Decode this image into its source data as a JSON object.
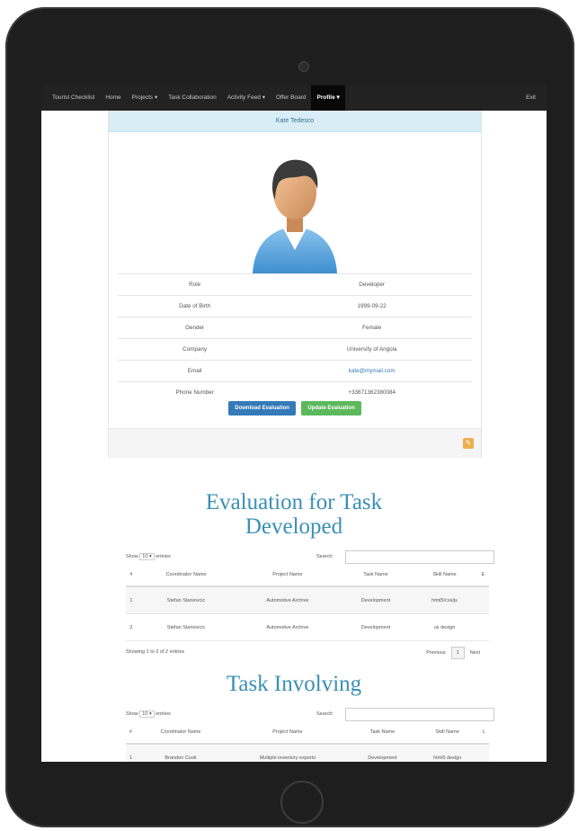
{
  "navbar": {
    "brand": "Tourist Checklist",
    "items": [
      "Home",
      "Projects ▾",
      "Task Collaboration",
      "Activity Feed ▾",
      "Offer Board",
      "Profile ▾"
    ],
    "right": "Exit"
  },
  "profile": {
    "name": "Kate Tedesco",
    "rows": [
      {
        "label": "Role",
        "value": "Developer"
      },
      {
        "label": "Date of Birth",
        "value": "1999-09-22"
      },
      {
        "label": "Gender",
        "value": "Female"
      },
      {
        "label": "Company",
        "value": "University of Angola"
      },
      {
        "label": "Email",
        "value": "kate@mymail.com"
      },
      {
        "label": "Phone Number",
        "value": "+33671362380084"
      }
    ],
    "download_label": "Download Evaluation",
    "update_label": "Update Evaluation",
    "edit_icon": "edit-icon",
    "colors": {
      "primary": "#337ab7",
      "success": "#5cb85c",
      "warning": "#f0ad4e",
      "heading": "#3a8fb5"
    }
  },
  "evaluation": {
    "title_line1": "Evaluation for Task",
    "title_line2": "Developed",
    "show_label": "Show",
    "entries_value": "10",
    "entries_label": "entries",
    "search_label": "Search:",
    "headers": [
      "#",
      "Coordinator Name",
      "Project Name",
      "Task Name",
      "Skill Name",
      "E"
    ],
    "rows": [
      [
        "1",
        "Stefan Staniovcic",
        "Automotive Archive",
        "Development",
        "html5/css/js",
        ""
      ],
      [
        "2",
        "Stefan Staniovcic",
        "Automotive Archive",
        "Development",
        "ux design",
        ""
      ]
    ],
    "info": "Showing 1 to 2 of 2 entries",
    "prev": "Previous",
    "page": "1",
    "next": "Next"
  },
  "involving": {
    "title": "Task Involving",
    "show_label": "Show",
    "entries_value": "10",
    "entries_label": "entries",
    "search_label": "Search:",
    "headers": [
      "#",
      "Coordinator Name",
      "Project Name",
      "Task Name",
      "Skill Name",
      "L"
    ],
    "rows": [
      [
        "1",
        "Brandon Cook",
        "Multiple inventory exports",
        "Development",
        "html5 design",
        ""
      ]
    ]
  }
}
